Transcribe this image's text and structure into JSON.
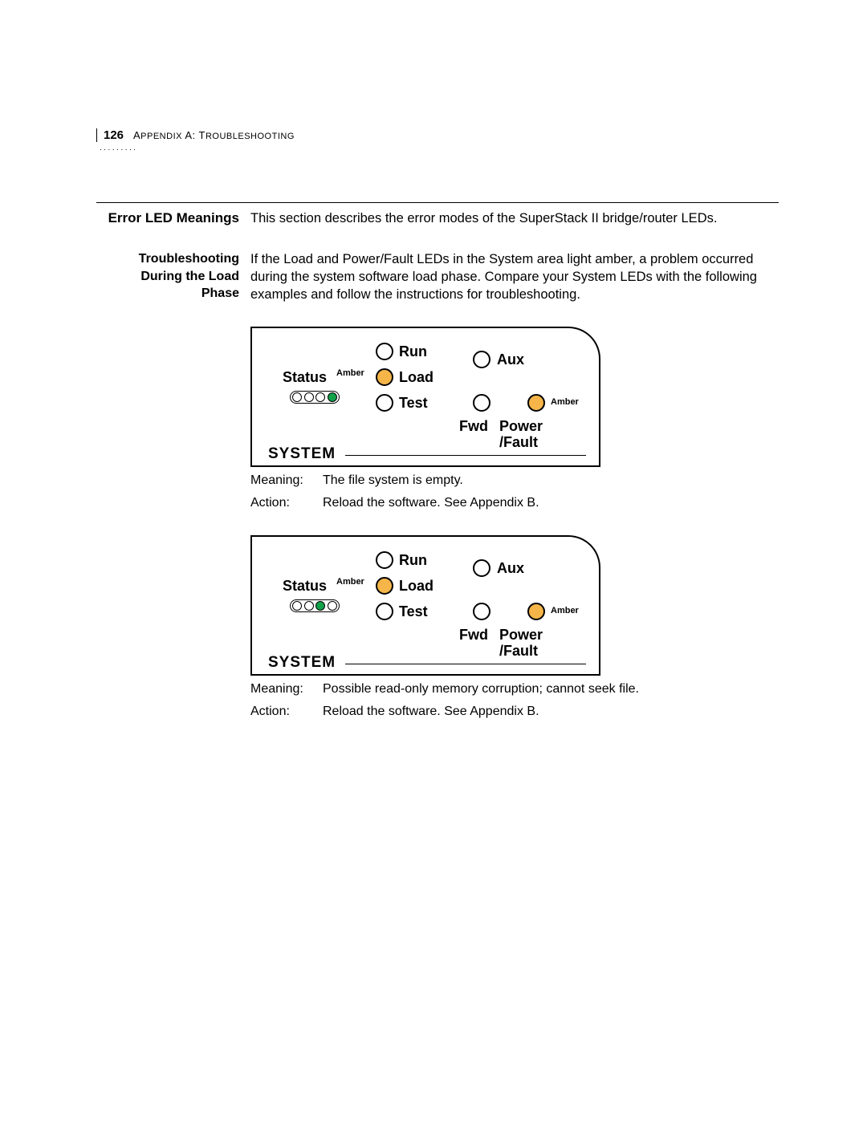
{
  "header": {
    "page_number": "126",
    "breadcrumb_a": "A",
    "breadcrumb_appendix": "PPENDIX",
    "breadcrumb_sep": " A: T",
    "breadcrumb_trouble": "ROUBLESHOOTING"
  },
  "section1": {
    "sidehead": "Error LED Meanings",
    "body": "This section describes the error modes of the SuperStack II bridge/router LEDs."
  },
  "section2": {
    "sidehead_l1": "Troubleshooting",
    "sidehead_l2": "During the Load",
    "sidehead_l3": "Phase",
    "body": "If the Load and Power/Fault LEDs in the System area light amber, a problem occurred during the system software load phase. Compare your System LEDs with the following examples and follow the instructions for troubleshooting."
  },
  "diagram1": {
    "labels": {
      "status": "Status",
      "amber_left": "Amber",
      "run": "Run",
      "load": "Load",
      "test": "Test",
      "aux": "Aux",
      "fwd": "Fwd",
      "power": "Power",
      "fault": "/Fault",
      "amber_right": "Amber",
      "system": "SYSTEM"
    },
    "status_pill_green_index": 3,
    "meaning_label": "Meaning:",
    "meaning_text": "The file system is empty.",
    "action_label": "Action:",
    "action_text": "Reload the software. See Appendix B."
  },
  "diagram2": {
    "labels": {
      "status": "Status",
      "amber_left": "Amber",
      "run": "Run",
      "load": "Load",
      "test": "Test",
      "aux": "Aux",
      "fwd": "Fwd",
      "power": "Power",
      "fault": "/Fault",
      "amber_right": "Amber",
      "system": "SYSTEM"
    },
    "status_pill_green_index": 2,
    "meaning_label": "Meaning:",
    "meaning_text": "Possible read-only memory corruption; cannot seek file.",
    "action_label": "Action:",
    "action_text": "Reload the software. See Appendix B."
  }
}
